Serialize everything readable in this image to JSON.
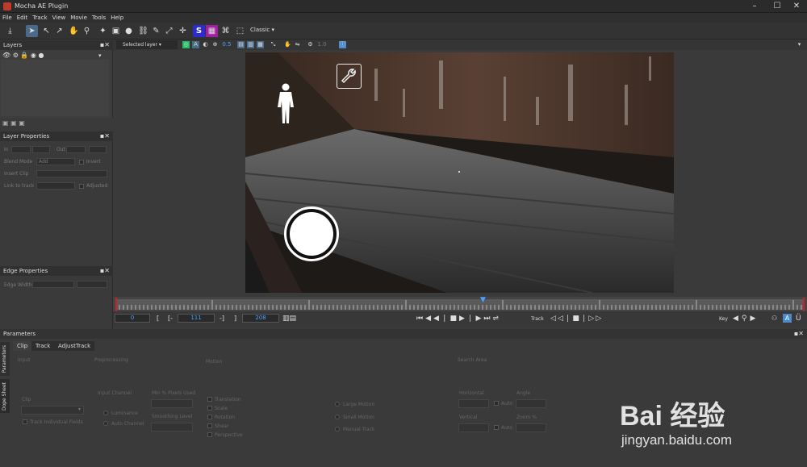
{
  "window": {
    "title": "Mocha AE Plugin",
    "minimize": "–",
    "maximize": "☐",
    "close": "✕"
  },
  "menu": [
    "File",
    "Edit",
    "Track",
    "View",
    "Movie",
    "Tools",
    "Help"
  ],
  "toolbar": {
    "workspace": "Classic"
  },
  "toolbar2": {
    "layer_select": "Selected layer",
    "opacity": "0.5",
    "value": "1.0"
  },
  "layers_panel": {
    "title": "Layers"
  },
  "layer_properties": {
    "title": "Layer Properties",
    "in": "In",
    "out": "Out",
    "blend_mode": "Blend Mode",
    "blend_value": "Add",
    "invert": "Invert",
    "insert_clip": "Insert Clip",
    "link_to_track": "Link to track",
    "adjusted": "Adjusted"
  },
  "edge_properties": {
    "title": "Edge Properties",
    "edge_width": "Edge Width"
  },
  "transport": {
    "current_frame": "0",
    "in_point": "111",
    "out_point": "208",
    "track_label": "Track",
    "key_label": "Key"
  },
  "parameters": {
    "title": "Parameters",
    "tabs": [
      "Clip",
      "Track",
      "AdjustTrack"
    ],
    "side_tabs": [
      "Parameters",
      "Dope Sheet"
    ],
    "input": "Input",
    "clip": "Clip",
    "track_individual_fields": "Track Individual Fields",
    "preprocessing": "Preprocessing",
    "input_channel": "Input Channel",
    "luminance": "Luminance",
    "auto_channel": "Auto Channel",
    "min_pixels_used": "Min % Pixels Used",
    "smoothing_level": "Smoothing Level",
    "motion": "Motion",
    "motion_items": [
      "Translation",
      "Scale",
      "Rotation",
      "Shear",
      "Perspective"
    ],
    "motion_type": [
      "Large Motion",
      "Small Motion",
      "Manual Track"
    ],
    "search_area": "Search Area",
    "horizontal": "Horizontal",
    "vertical": "Vertical",
    "angle": "Angle",
    "zoom": "Zoom %",
    "auto": "Auto"
  },
  "watermark": {
    "text": "Bai 经验",
    "url": "jingyan.baidu.com"
  },
  "colors": {
    "accent": "#4aa0ff",
    "bg": "#3a3a3a",
    "header": "#303030",
    "tool_blue": "#2b2bd0"
  }
}
